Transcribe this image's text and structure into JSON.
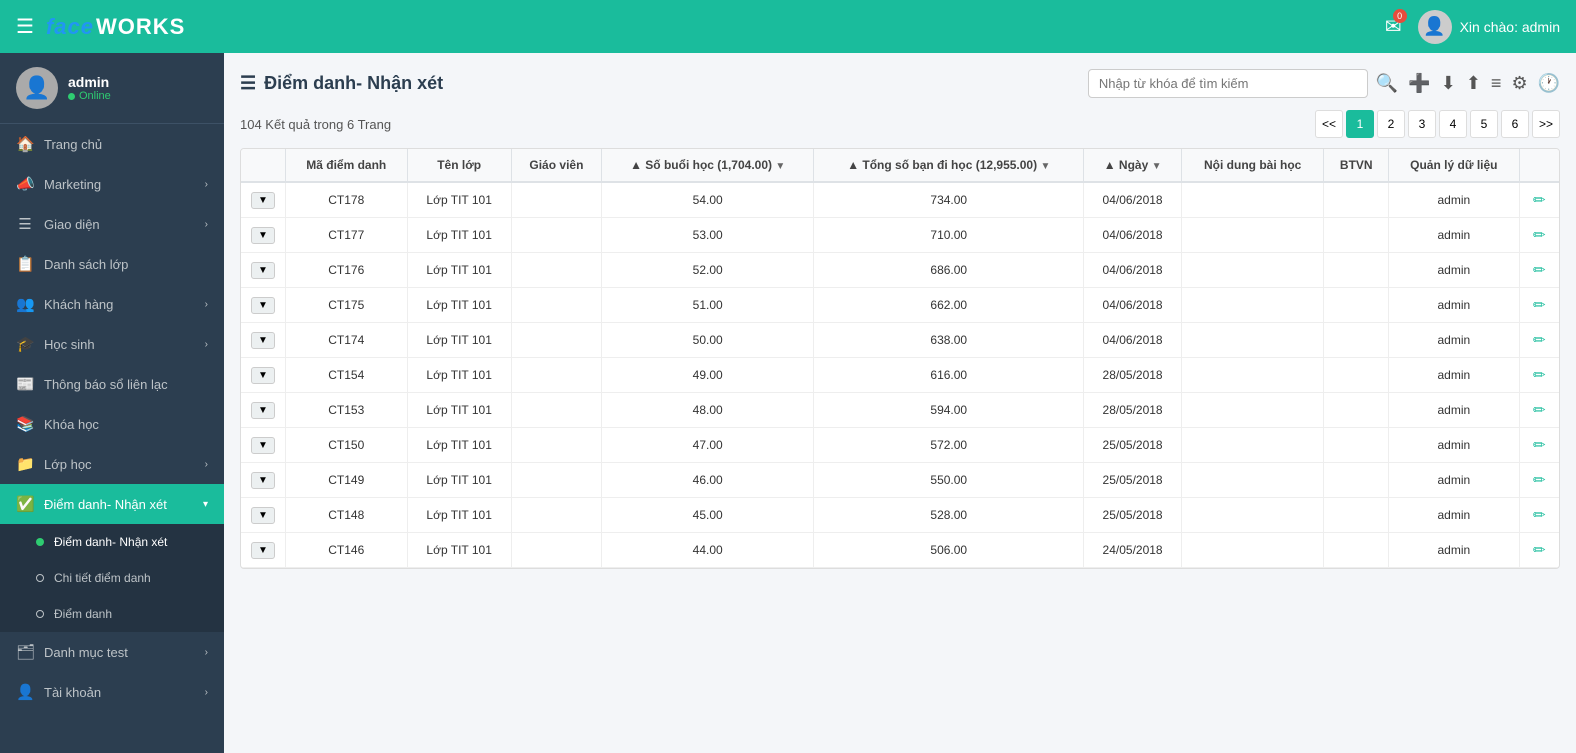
{
  "topbar": {
    "logo_face": "face",
    "logo_works": "WORKS",
    "menu_icon": "☰",
    "mail_badge": "0",
    "greeting": "Xin chào: admin"
  },
  "sidebar": {
    "profile": {
      "name": "admin",
      "status": "Online"
    },
    "items": [
      {
        "id": "trang-chu",
        "icon": "🏠",
        "label": "Trang chủ",
        "has_arrow": false
      },
      {
        "id": "marketing",
        "icon": "📣",
        "label": "Marketing",
        "has_arrow": true
      },
      {
        "id": "giao-dien",
        "icon": "☰",
        "label": "Giao diện",
        "has_arrow": true
      },
      {
        "id": "danh-sach-lop",
        "icon": "📋",
        "label": "Danh sách lớp",
        "has_arrow": false
      },
      {
        "id": "khach-hang",
        "icon": "👥",
        "label": "Khách hàng",
        "has_arrow": true
      },
      {
        "id": "hoc-sinh",
        "icon": "🎓",
        "label": "Học sinh",
        "has_arrow": true
      },
      {
        "id": "thong-bao",
        "icon": "📰",
        "label": "Thông báo sổ liên lạc",
        "has_arrow": false
      },
      {
        "id": "khoa-hoc",
        "icon": "📚",
        "label": "Khóa học",
        "has_arrow": false
      },
      {
        "id": "lop-hoc",
        "icon": "📁",
        "label": "Lớp học",
        "has_arrow": true
      },
      {
        "id": "diem-danh",
        "icon": "✅",
        "label": "Điểm danh- Nhận xét",
        "has_arrow": true,
        "active": true
      }
    ],
    "submenu": [
      {
        "id": "diem-danh-nhan-xet",
        "label": "Điểm danh- Nhận xét",
        "dot_type": "filled",
        "active": true
      },
      {
        "id": "chi-tiet-diem-danh",
        "label": "Chi tiết điểm danh",
        "dot_type": "empty"
      },
      {
        "id": "diem-danh-sub",
        "label": "Điểm danh",
        "dot_type": "empty"
      }
    ],
    "extra_items": [
      {
        "id": "danh-muc-test",
        "icon": "🗂",
        "label": "Danh mục test",
        "has_arrow": true
      },
      {
        "id": "tai-khoan",
        "icon": "👤",
        "label": "Tài khoản",
        "has_arrow": true
      }
    ]
  },
  "page": {
    "title": "Điểm danh- Nhận xét",
    "result_info": "104 Kết quả trong 6 Trang",
    "search_placeholder": "Nhập từ khóa để tìm kiếm"
  },
  "pagination": {
    "prev": "<<",
    "next": ">>",
    "pages": [
      "1",
      "2",
      "3",
      "4",
      "5",
      "6"
    ],
    "active_page": "1"
  },
  "table": {
    "columns": [
      {
        "id": "expand",
        "label": ""
      },
      {
        "id": "ma-diem-danh",
        "label": "Mã điểm danh",
        "sortable": false
      },
      {
        "id": "ten-lop",
        "label": "Tên lớp",
        "sortable": false
      },
      {
        "id": "giao-vien",
        "label": "Giáo viên",
        "sortable": false
      },
      {
        "id": "so-buoi-hoc",
        "label": "▲ Số buổi học (1,704.00) ▼",
        "sortable": true
      },
      {
        "id": "tong-so-ban",
        "label": "▲ Tổng số bạn đi học (12,955.00) ▼",
        "sortable": true
      },
      {
        "id": "ngay",
        "label": "▲ Ngày ▼",
        "sortable": true
      },
      {
        "id": "noi-dung",
        "label": "Nội dung bài học",
        "sortable": false
      },
      {
        "id": "btvn",
        "label": "BTVN",
        "sortable": false
      },
      {
        "id": "quan-ly",
        "label": "Quản lý dữ liệu",
        "sortable": false
      },
      {
        "id": "action",
        "label": "",
        "sortable": false
      }
    ],
    "rows": [
      {
        "ma": "CT178",
        "lop": "Lớp TIT 101",
        "giao_vien": "",
        "so_buoi": "54.00",
        "tong_so": "734.00",
        "ngay": "04/06/2018",
        "noi_dung": "",
        "btvn": "",
        "quan_ly": "admin"
      },
      {
        "ma": "CT177",
        "lop": "Lớp TIT 101",
        "giao_vien": "",
        "so_buoi": "53.00",
        "tong_so": "710.00",
        "ngay": "04/06/2018",
        "noi_dung": "",
        "btvn": "",
        "quan_ly": "admin"
      },
      {
        "ma": "CT176",
        "lop": "Lớp TIT 101",
        "giao_vien": "",
        "so_buoi": "52.00",
        "tong_so": "686.00",
        "ngay": "04/06/2018",
        "noi_dung": "",
        "btvn": "",
        "quan_ly": "admin"
      },
      {
        "ma": "CT175",
        "lop": "Lớp TIT 101",
        "giao_vien": "",
        "so_buoi": "51.00",
        "tong_so": "662.00",
        "ngay": "04/06/2018",
        "noi_dung": "",
        "btvn": "",
        "quan_ly": "admin"
      },
      {
        "ma": "CT174",
        "lop": "Lớp TIT 101",
        "giao_vien": "",
        "so_buoi": "50.00",
        "tong_so": "638.00",
        "ngay": "04/06/2018",
        "noi_dung": "",
        "btvn": "",
        "quan_ly": "admin"
      },
      {
        "ma": "CT154",
        "lop": "Lớp TIT 101",
        "giao_vien": "",
        "so_buoi": "49.00",
        "tong_so": "616.00",
        "ngay": "28/05/2018",
        "noi_dung": "",
        "btvn": "",
        "quan_ly": "admin"
      },
      {
        "ma": "CT153",
        "lop": "Lớp TIT 101",
        "giao_vien": "",
        "so_buoi": "48.00",
        "tong_so": "594.00",
        "ngay": "28/05/2018",
        "noi_dung": "",
        "btvn": "",
        "quan_ly": "admin"
      },
      {
        "ma": "CT150",
        "lop": "Lớp TIT 101",
        "giao_vien": "",
        "so_buoi": "47.00",
        "tong_so": "572.00",
        "ngay": "25/05/2018",
        "noi_dung": "",
        "btvn": "",
        "quan_ly": "admin"
      },
      {
        "ma": "CT149",
        "lop": "Lớp TIT 101",
        "giao_vien": "",
        "so_buoi": "46.00",
        "tong_so": "550.00",
        "ngay": "25/05/2018",
        "noi_dung": "",
        "btvn": "",
        "quan_ly": "admin"
      },
      {
        "ma": "CT148",
        "lop": "Lớp TIT 101",
        "giao_vien": "",
        "so_buoi": "45.00",
        "tong_so": "528.00",
        "ngay": "25/05/2018",
        "noi_dung": "",
        "btvn": "",
        "quan_ly": "admin"
      },
      {
        "ma": "CT146",
        "lop": "Lớp TIT 101",
        "giao_vien": "",
        "so_buoi": "44.00",
        "tong_so": "506.00",
        "ngay": "24/05/2018",
        "noi_dung": "",
        "btvn": "",
        "quan_ly": "admin"
      }
    ]
  }
}
